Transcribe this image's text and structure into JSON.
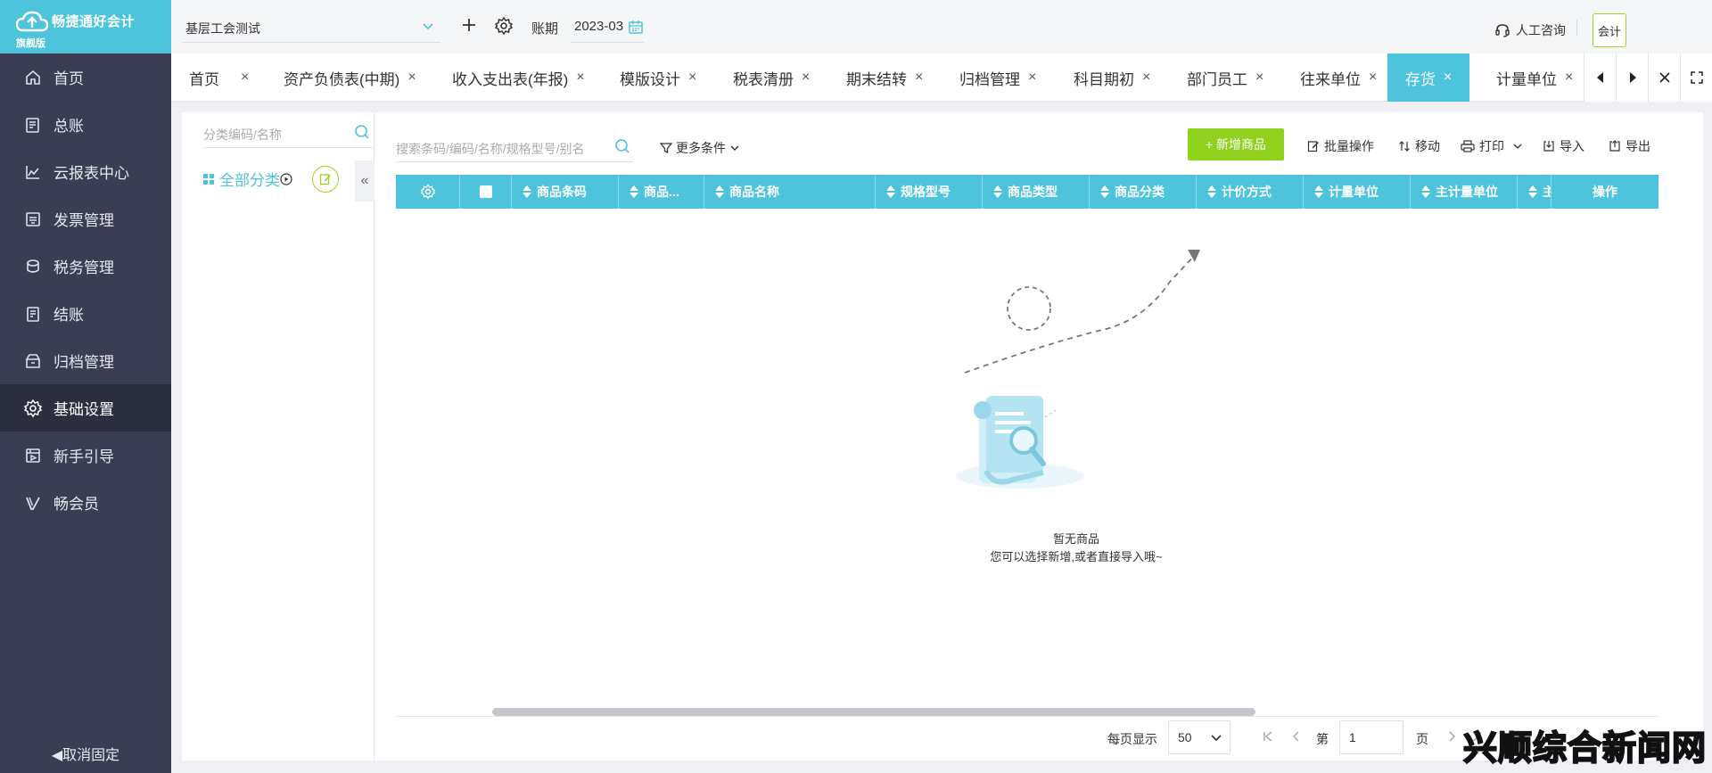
{
  "app": {
    "brand": "畅捷通好会计",
    "edition": "旗舰版",
    "accent_color": "#4ec3dc",
    "sidebar_color": "#3a3e52",
    "primary_button_color": "#8fd11c"
  },
  "sidebar": {
    "items": [
      {
        "label": "首页",
        "icon": "home-icon"
      },
      {
        "label": "总账",
        "icon": "ledger-icon"
      },
      {
        "label": "云报表中心",
        "icon": "chart-icon"
      },
      {
        "label": "发票管理",
        "icon": "invoice-icon"
      },
      {
        "label": "税务管理",
        "icon": "tax-icon"
      },
      {
        "label": "结账",
        "icon": "checkout-icon"
      },
      {
        "label": "归档管理",
        "icon": "archive-icon"
      },
      {
        "label": "基础设置",
        "icon": "gear-icon",
        "active": true
      },
      {
        "label": "新手引导",
        "icon": "guide-icon"
      },
      {
        "label": "畅会员",
        "icon": "vip-icon"
      }
    ],
    "unpin_label": "◀取消固定"
  },
  "topbar": {
    "company": "基层工会测试",
    "period_label": "账期",
    "period_value": "2023-03",
    "consult_label": "人工咨询",
    "role_label": "会计"
  },
  "tabs": [
    {
      "label": "首页"
    },
    {
      "label": "资产负债表(中期)"
    },
    {
      "label": "收入支出表(年报)"
    },
    {
      "label": "模版设计"
    },
    {
      "label": "税表清册"
    },
    {
      "label": "期末结转"
    },
    {
      "label": "归档管理"
    },
    {
      "label": "科目期初"
    },
    {
      "label": "部门员工"
    },
    {
      "label": "往来单位"
    },
    {
      "label": "存货",
      "active": true
    },
    {
      "label": "计量单位"
    }
  ],
  "tab_close_glyph": "×",
  "category": {
    "search_placeholder": "分类编码/名称",
    "all_label": "全部分类",
    "collapse_glyph": "«"
  },
  "toolbar": {
    "search_placeholder": "搜索条码/编码/名称/规格型号/别名",
    "more_conditions": "更多条件",
    "add_label": "+ 新增商品",
    "batch_label": "批量操作",
    "move_label": "移动",
    "print_label": "打印",
    "import_label": "导入",
    "export_label": "导出"
  },
  "table": {
    "columns": [
      "商品条码",
      "商品...",
      "商品名称",
      "规格型号",
      "商品类型",
      "商品分类",
      "计价方式",
      "计量单位",
      "主计量单位",
      "主",
      "操作"
    ]
  },
  "empty": {
    "title": "暂无商品",
    "subtitle": "您可以选择新增,或者直接导入哦~"
  },
  "pagination": {
    "per_page_label": "每页显示",
    "per_page_value": "50",
    "page_prefix": "第",
    "page_value": "1",
    "page_suffix": "页"
  },
  "watermark": "兴顺综合新闻网"
}
